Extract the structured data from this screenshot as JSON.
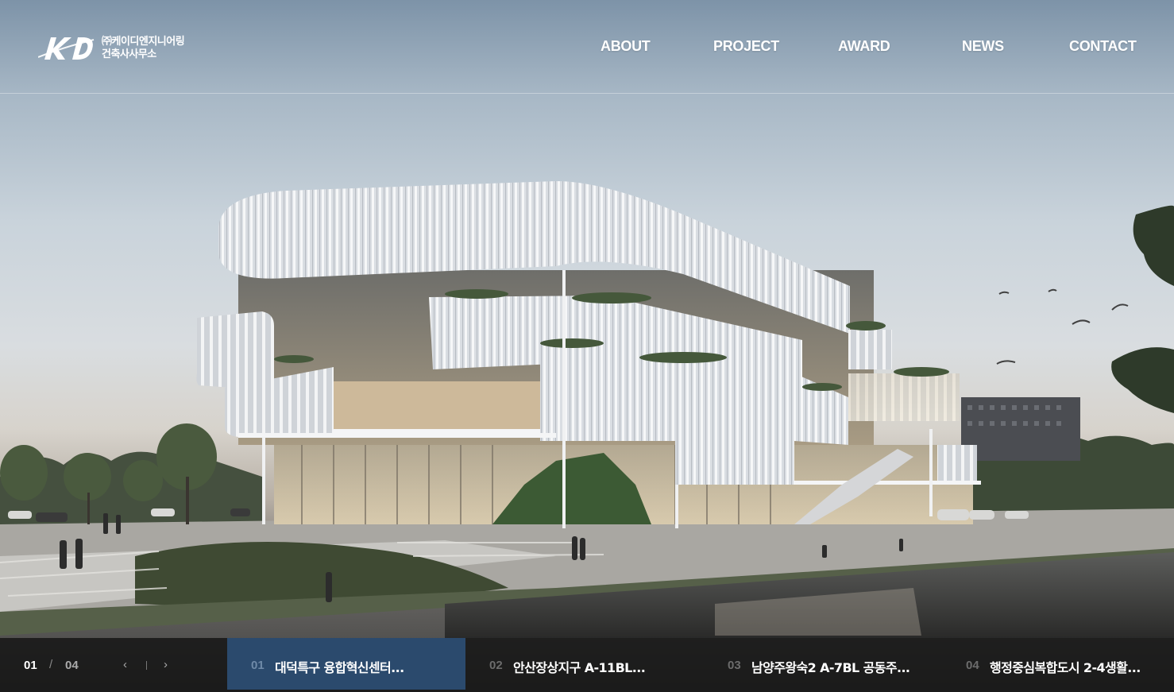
{
  "brand": {
    "logo_mark": "KD",
    "company_line1": "㈜케이디엔지니어링",
    "company_line2": "건축사사무소"
  },
  "nav": {
    "items": [
      {
        "label": "ABOUT"
      },
      {
        "label": "PROJECT"
      },
      {
        "label": "AWARD"
      },
      {
        "label": "NEWS"
      },
      {
        "label": "CONTACT"
      }
    ]
  },
  "hero": {
    "image": "architectural-rendering-white-louvered-building-riverside"
  },
  "slider": {
    "current": "01",
    "separator": "/",
    "total": "04",
    "prev_icon": "‹",
    "next_icon": "›",
    "active_index": 0,
    "active_color": "#2b4a6d",
    "slides": [
      {
        "num": "01",
        "title": "대덕특구 융합혁신센터..."
      },
      {
        "num": "02",
        "title": "안산장상지구 A-11BL..."
      },
      {
        "num": "03",
        "title": "남양주왕숙2 A-7BL 공동주..."
      },
      {
        "num": "04",
        "title": "행정중심복합도시 2-4생활..."
      }
    ]
  }
}
